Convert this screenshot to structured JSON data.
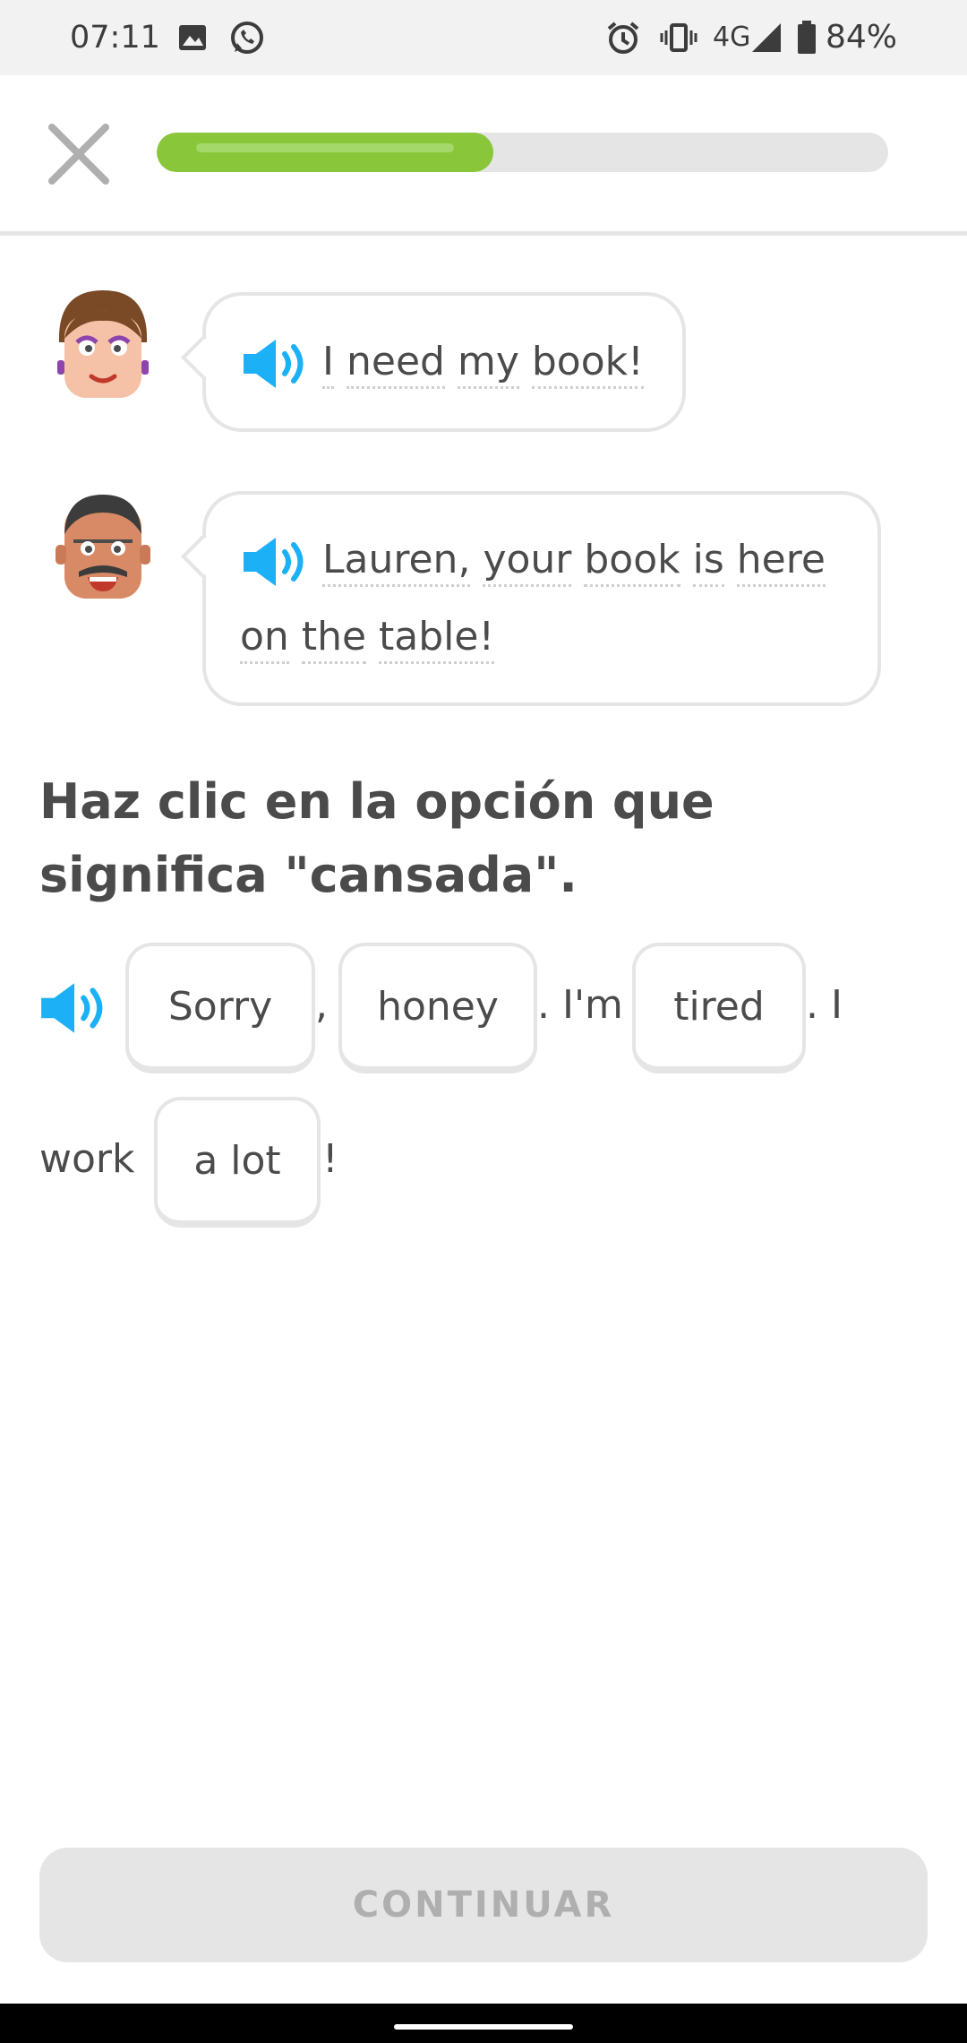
{
  "status_bar": {
    "time": "07:11",
    "network": "4G",
    "battery_percent": "84%",
    "icons": [
      "image-icon",
      "whatsapp-icon",
      "alarm-icon",
      "vibrate-icon",
      "signal-icon",
      "battery-icon"
    ]
  },
  "header": {
    "close_icon": "close-icon",
    "progress": 0.46,
    "progress_color": "#89c63a"
  },
  "conversation": [
    {
      "speaker": "woman-avatar",
      "segments": [
        "I",
        "need",
        "my",
        "book!"
      ]
    },
    {
      "speaker": "man-avatar",
      "line1": [
        "Lauren,",
        "your",
        "book",
        "is",
        "here"
      ],
      "line2": [
        "on",
        "the",
        "table!"
      ]
    }
  ],
  "prompt": {
    "line1": "Haz clic en la opción que",
    "line2": "significa \"cansada\"."
  },
  "sentence": {
    "chips": [
      "Sorry",
      "honey",
      "tired",
      "a lot"
    ],
    "text": [
      ",",
      ". I'm",
      ". I",
      "work",
      "!"
    ]
  },
  "continue_button": {
    "label": "CONTINUAR"
  },
  "colors": {
    "speaker_blue": "#1cb0f6",
    "border_gray": "#e5e5e5",
    "disabled_text": "#afafaf"
  }
}
